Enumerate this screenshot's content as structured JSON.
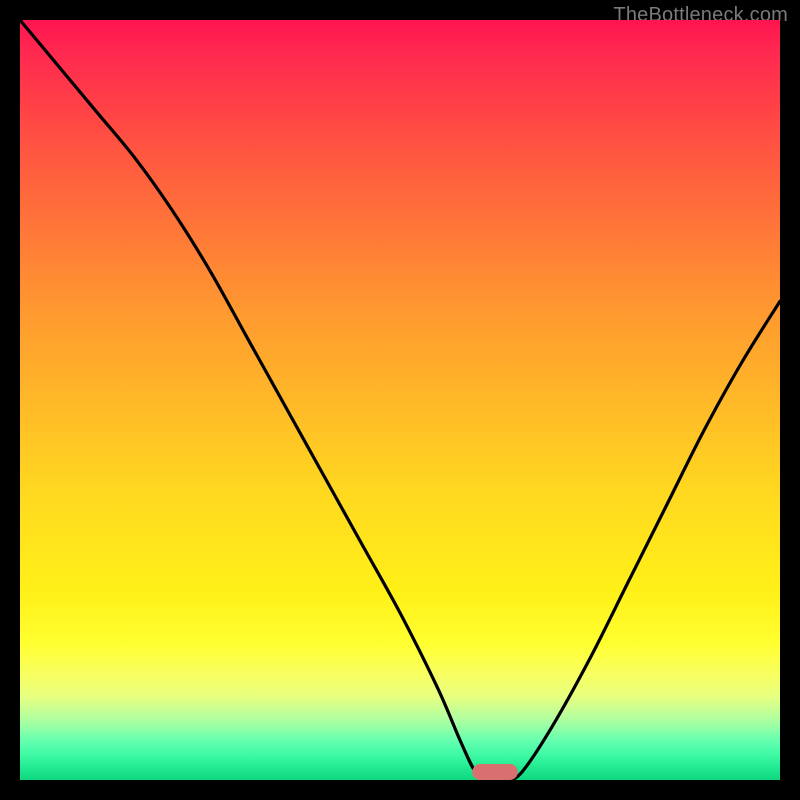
{
  "watermark": "TheBottleneck.com",
  "chart_data": {
    "type": "line",
    "title": "",
    "xlabel": "",
    "ylabel": "",
    "xlim": [
      0,
      100
    ],
    "ylim": [
      0,
      100
    ],
    "grid": false,
    "legend": false,
    "series": [
      {
        "name": "bottleneck-curve",
        "x": [
          0,
          5,
          10,
          15,
          20,
          25,
          30,
          35,
          40,
          45,
          50,
          55,
          58,
          60,
          62,
          64,
          66,
          70,
          75,
          80,
          85,
          90,
          95,
          100
        ],
        "y": [
          100,
          94,
          88,
          82,
          75,
          67,
          58,
          49,
          40,
          31,
          22,
          12,
          5,
          1,
          0,
          0,
          1,
          7,
          16,
          26,
          36,
          46,
          55,
          63
        ]
      }
    ],
    "marker": {
      "name": "optimal-range",
      "x_center": 62.5,
      "width_pct": 6,
      "color": "#d87070"
    },
    "background_gradient": {
      "top": "#ff1450",
      "mid": "#ffe028",
      "bottom": "#18e088"
    }
  }
}
